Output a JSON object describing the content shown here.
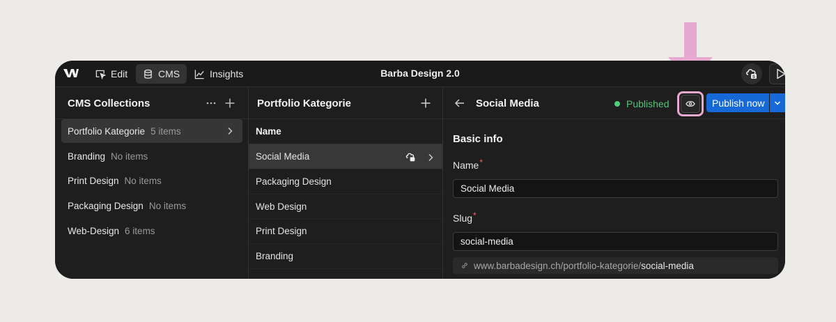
{
  "topbar": {
    "edit_label": "Edit",
    "cms_label": "CMS",
    "insights_label": "Insights",
    "title": "Barba Design 2.0"
  },
  "collections": {
    "title": "CMS Collections",
    "items": [
      {
        "name": "Portfolio Kategorie",
        "count": "5 items"
      },
      {
        "name": "Branding",
        "count": "No items"
      },
      {
        "name": "Print Design",
        "count": "No items"
      },
      {
        "name": "Packaging Design",
        "count": "No items"
      },
      {
        "name": "Web-Design",
        "count": "6 items"
      }
    ]
  },
  "items_panel": {
    "title": "Portfolio Kategorie",
    "column_header": "Name",
    "rows": [
      "Social Media",
      "Packaging Design",
      "Web Design",
      "Print Design",
      "Branding"
    ]
  },
  "editor": {
    "title": "Social Media",
    "status": "Published",
    "publish_label": "Publish now",
    "section_title": "Basic info",
    "name_label": "Name",
    "name_value": "Social Media",
    "slug_label": "Slug",
    "slug_value": "social-media",
    "required_mark": "*",
    "url_base": "www.barbadesign.ch/portfolio-kategorie/",
    "url_slug": "social-media"
  },
  "colors": {
    "accent": "#1769d8",
    "status_green": "#4cd07a",
    "highlight_pink": "#e7a9d0",
    "required_red": "#ff5a6e"
  },
  "icons": [
    "webflow-logo-icon",
    "cursor-edit-icon",
    "database-icon",
    "chart-line-icon",
    "collaboration-icon",
    "play-icon",
    "more-icon",
    "plus-icon",
    "chevron-right-icon",
    "arrow-left-icon",
    "eye-icon",
    "chevron-down-icon",
    "link-icon",
    "arrow-down-icon"
  ]
}
